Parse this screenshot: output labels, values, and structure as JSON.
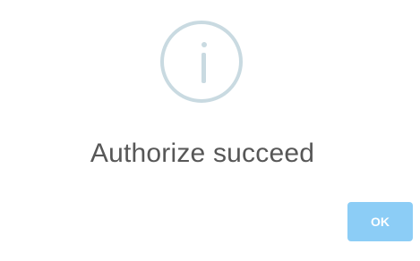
{
  "dialog": {
    "icon": "info-circle-icon",
    "title": "Authorize succeed",
    "confirm_button_label": "OK"
  },
  "colors": {
    "icon": "#c9dae1",
    "title_text": "#575757",
    "button_background": "#8ccdf6",
    "button_text": "#ffffff"
  }
}
